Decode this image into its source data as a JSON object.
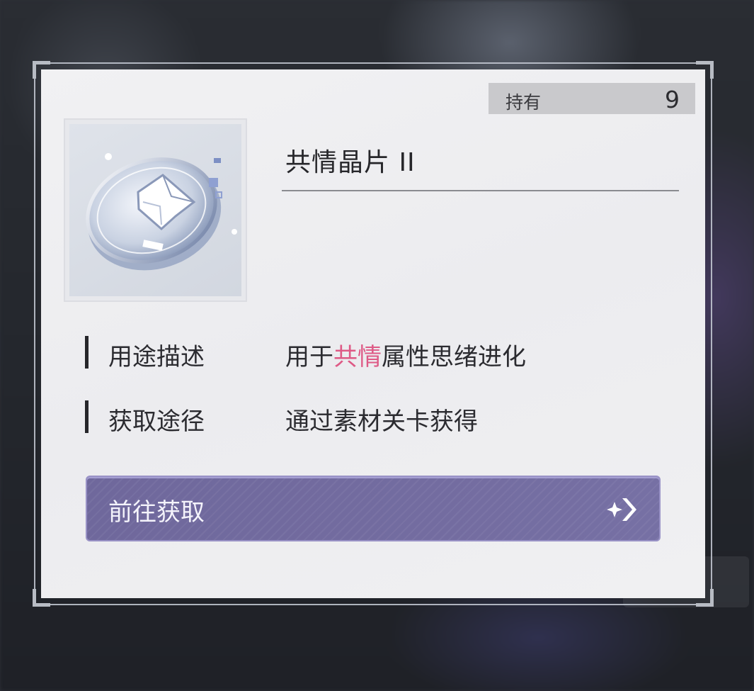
{
  "popup": {
    "owned_label": "持有",
    "owned_count": "9",
    "item_name": "共情晶片 II",
    "item_icon": "empathy-chip-icon",
    "rows": [
      {
        "label": "用途描述",
        "value_prefix": "用于",
        "value_highlight": "共情",
        "value_suffix": "属性思绪进化"
      },
      {
        "label": "获取途径",
        "value": "通过素材关卡获得"
      }
    ],
    "go_button_label": "前往获取",
    "go_button_icon": "arrow-right-icon",
    "accent_color": "#de5a86",
    "button_color": "#716a9e"
  }
}
